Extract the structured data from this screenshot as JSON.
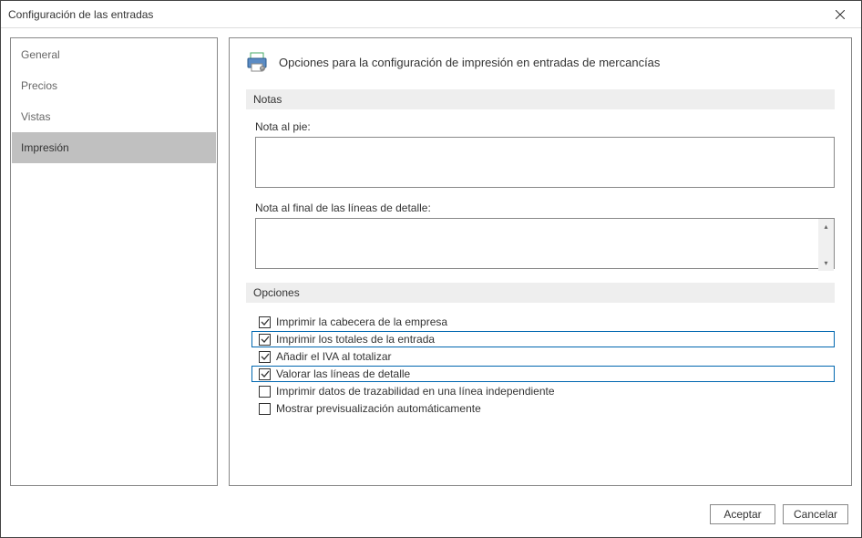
{
  "window": {
    "title": "Configuración de las entradas"
  },
  "sidebar": {
    "items": [
      {
        "label": "General"
      },
      {
        "label": "Precios"
      },
      {
        "label": "Vistas"
      },
      {
        "label": "Impresión"
      }
    ]
  },
  "header": {
    "text": "Opciones para la configuración de impresión en entradas de mercancías"
  },
  "sections": {
    "notas": {
      "title": "Notas",
      "footnote_label": "Nota al pie:",
      "footnote_value": "",
      "endnote_label": "Nota al final de las líneas de detalle:",
      "endnote_value": ""
    },
    "opciones": {
      "title": "Opciones",
      "items": [
        {
          "label": "Imprimir la cabecera de la empresa",
          "checked": true,
          "highlighted": false
        },
        {
          "label": "Imprimir los totales de la entrada",
          "checked": true,
          "highlighted": true
        },
        {
          "label": "Añadir el IVA al totalizar",
          "checked": true,
          "highlighted": false
        },
        {
          "label": "Valorar las líneas de detalle",
          "checked": true,
          "highlighted": true
        },
        {
          "label": "Imprimir datos de trazabilidad en una línea independiente",
          "checked": false,
          "highlighted": false
        },
        {
          "label": "Mostrar previsualización automáticamente",
          "checked": false,
          "highlighted": false
        }
      ]
    }
  },
  "buttons": {
    "ok": "Aceptar",
    "cancel": "Cancelar"
  }
}
